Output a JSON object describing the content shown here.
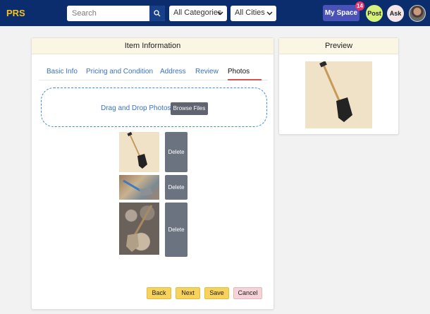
{
  "header": {
    "brand": "PRS",
    "search_placeholder": "Search",
    "category_select": "All Categories",
    "city_select": "All Cities",
    "my_space_label": "My Space",
    "notification_count": "14",
    "post_label": "Post",
    "ask_label": "Ask"
  },
  "item_panel": {
    "title": "Item Information",
    "tabs": [
      {
        "label": "Basic Info"
      },
      {
        "label": "Pricing and Condition"
      },
      {
        "label": "Address"
      },
      {
        "label": "Review"
      },
      {
        "label": "Photos",
        "active": true
      }
    ],
    "dropzone_text": "Drag and Drop Photos",
    "browse_label": "Browse Files",
    "photos": [
      {
        "delete_label": "Delete"
      },
      {
        "delete_label": "Delete"
      },
      {
        "delete_label": "Delete"
      }
    ],
    "buttons": {
      "back": "Back",
      "next": "Next",
      "save": "Save",
      "cancel": "Cancel"
    }
  },
  "preview_panel": {
    "title": "Preview"
  },
  "colors": {
    "navbar": "#0b2d6e",
    "brand": "#f6c21c",
    "tab_link": "#3a73c4",
    "active_underline": "#d9534f",
    "action_button": "#f7d35e",
    "cancel_button": "#f6d3d8",
    "delete_button": "#6b7280"
  },
  "icons": [
    "search-icon",
    "chevron-down-icon"
  ]
}
